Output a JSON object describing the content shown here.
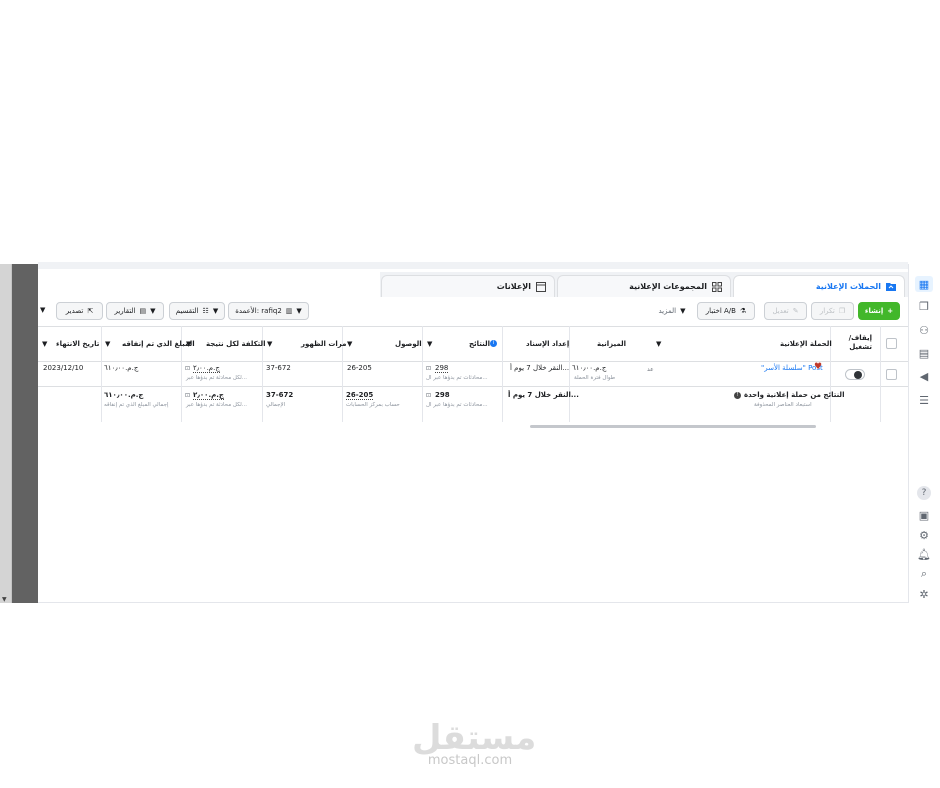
{
  "tabs": [
    {
      "label": "الحملات الإعلانية",
      "active": true,
      "icon": "folder-icon"
    },
    {
      "label": "المجموعات الإعلانية",
      "active": false,
      "icon": "grid-icon"
    },
    {
      "label": "الإعلانات",
      "active": false,
      "icon": "ad-icon"
    }
  ],
  "toolbar": {
    "create": "إنشاء",
    "duplicate": "تكرار",
    "edit": "تعديل",
    "ab_test": "اختبار A/B",
    "more": "المزيد",
    "columns": "الأعمدة: rafiq2",
    "breakdown": "التقسيم",
    "reports": "التقارير",
    "export": "تصدير"
  },
  "table": {
    "headers": {
      "toggle": "إيقاف/ تشغيل",
      "campaign": "الحملة الإعلانية",
      "budget": "الميزانية",
      "attribution": "إعداد الإسناد",
      "results": "النتائج",
      "reach": "الوصول",
      "impressions": "مرات الظهور",
      "cost_per_result": "التكلفة لكل نتيجة",
      "amount_spent": "المبلغ الذي تم إنفاقه",
      "ends": "تاريخ الانتهاء"
    },
    "row": {
      "campaign_name": "\"سلسلة الأسر\" Post",
      "campaign_extra": "عد",
      "budget": "ج.م.‏٦١٠٫٠٠",
      "budget_sub": "طوال فترة الحملة",
      "attribution": "النقر خلال 7 يوم أ...",
      "results": "298",
      "results_sub": "محادثات تم بدؤها عبر ال...",
      "reach": "26-205",
      "impressions": "37-672",
      "cost": "ج.م.‏٢٫٠٠",
      "cost_sub": "لكل محادثة تم بدؤها عبر...",
      "spent": "ج.م.‏٦١٠٫٠٠",
      "ends": "2023/12/10"
    },
    "summary": {
      "label": "النتائج من حملة إعلانية واحدة",
      "sub": "استبعاد العناصر المحذوفة",
      "attribution": "النقر خلال 7 يوم أ...",
      "results": "298",
      "results_sub": "محادثات تم بدؤها عبر ال...",
      "reach": "26-205",
      "reach_sub": "حساب بمركز الحسابات",
      "impressions": "37-672",
      "impressions_sub": "الإجمالي",
      "cost": "ج.م.‏٢٫٠٠",
      "cost_sub": "لكل محادثة تم بدؤها عبر...",
      "spent": "ج.م.‏٦١٠٫٠٠",
      "spent_sub": "إجمالي المبلغ الذي تم إنفاقه"
    }
  },
  "sidebar_icons": [
    "table-icon",
    "pages-icon",
    "audience-icon",
    "catalog-icon",
    "megaphone-icon",
    "menu-icon",
    "help-icon",
    "billing-icon",
    "settings-icon",
    "bell-icon",
    "search-icon",
    "bug-icon"
  ],
  "watermark": {
    "arabic": "مستقل",
    "latin": "mostaql.com"
  },
  "colors": {
    "accent": "#1877f2",
    "create": "#42b72a"
  }
}
